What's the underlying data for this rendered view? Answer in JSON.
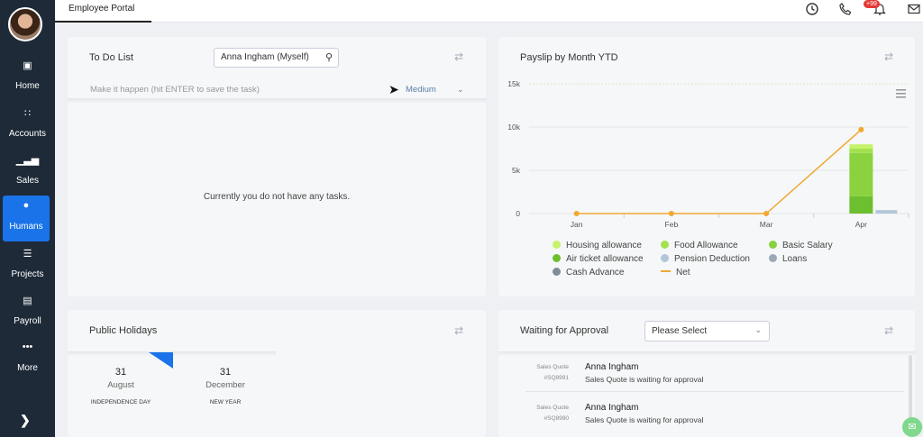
{
  "sidebar": {
    "items": [
      {
        "label": "Home",
        "icon": "home-icon",
        "glyph": "▣"
      },
      {
        "label": "Accounts",
        "icon": "grid-icon",
        "glyph": "∷"
      },
      {
        "label": "Sales",
        "icon": "bar-chart-icon",
        "glyph": "▁▃▅"
      },
      {
        "label": "Humans",
        "icon": "person-icon",
        "glyph": "●"
      },
      {
        "label": "Projects",
        "icon": "list-icon",
        "glyph": "☰"
      },
      {
        "label": "Payroll",
        "icon": "wallet-icon",
        "glyph": "▤"
      },
      {
        "label": "More",
        "icon": "dots-icon",
        "glyph": "•••"
      }
    ],
    "active": "Humans",
    "expand_glyph": "❯"
  },
  "topbar": {
    "tab_label": "Employee Portal",
    "notification_badge": "+99",
    "icons": [
      "clock-icon",
      "phone-icon",
      "bell-icon",
      "mail-icon"
    ]
  },
  "todo": {
    "title": "To Do List",
    "assignee": "Anna Ingham (Myself)",
    "placeholder": "Make it happen (hit ENTER to save the task)",
    "priority": "Medium",
    "empty_message": "Currently you do not have any tasks."
  },
  "payslip": {
    "title": "Payslip by Month YTD"
  },
  "chart_data": {
    "type": "bar",
    "categories": [
      "Jan",
      "Feb",
      "Mar",
      "Apr"
    ],
    "ylim": [
      0,
      15000
    ],
    "yticks": [
      "0",
      "5k",
      "10k",
      "15k"
    ],
    "stacked": true,
    "series": [
      {
        "name": "Housing allowance",
        "color": "#c6f36b",
        "values": [
          0,
          0,
          0,
          500
        ]
      },
      {
        "name": "Food Allowance",
        "color": "#a3e14f",
        "values": [
          0,
          0,
          0,
          500
        ]
      },
      {
        "name": "Basic Salary",
        "color": "#8ad23e",
        "values": [
          0,
          0,
          0,
          5000
        ]
      },
      {
        "name": "Air ticket allowance",
        "color": "#6cbf2e",
        "values": [
          0,
          0,
          0,
          2000
        ]
      },
      {
        "name": "Pension Deduction",
        "color": "#b3c6d9",
        "values": [
          0,
          0,
          0,
          400
        ]
      },
      {
        "name": "Loans",
        "color": "#9aa8b8",
        "values": [
          0,
          0,
          0,
          0
        ]
      },
      {
        "name": "Cash Advance",
        "color": "#7f8c99",
        "values": [
          0,
          0,
          0,
          0
        ]
      }
    ],
    "line": {
      "name": "Net",
      "color": "#f0a830",
      "values": [
        0,
        0,
        0,
        9700
      ]
    },
    "legend_position": "bottom",
    "grid": "horizontal"
  },
  "holidays": {
    "title": "Public Holidays",
    "items": [
      {
        "day": "31",
        "month": "August",
        "name": "INDEPENDENCE DAY"
      },
      {
        "day": "31",
        "month": "December",
        "name": "NEW YEAR"
      }
    ]
  },
  "approval": {
    "title": "Waiting for Approval",
    "select_value": "Please Select",
    "rows": [
      {
        "type": "Sales Quote",
        "ref": "#SQ8991",
        "who": "Anna Ingham",
        "msg": "Sales Quote is waiting for approval"
      },
      {
        "type": "Sales Quote",
        "ref": "#SQ8990",
        "who": "Anna Ingham",
        "msg": "Sales Quote is waiting for approval"
      }
    ]
  }
}
